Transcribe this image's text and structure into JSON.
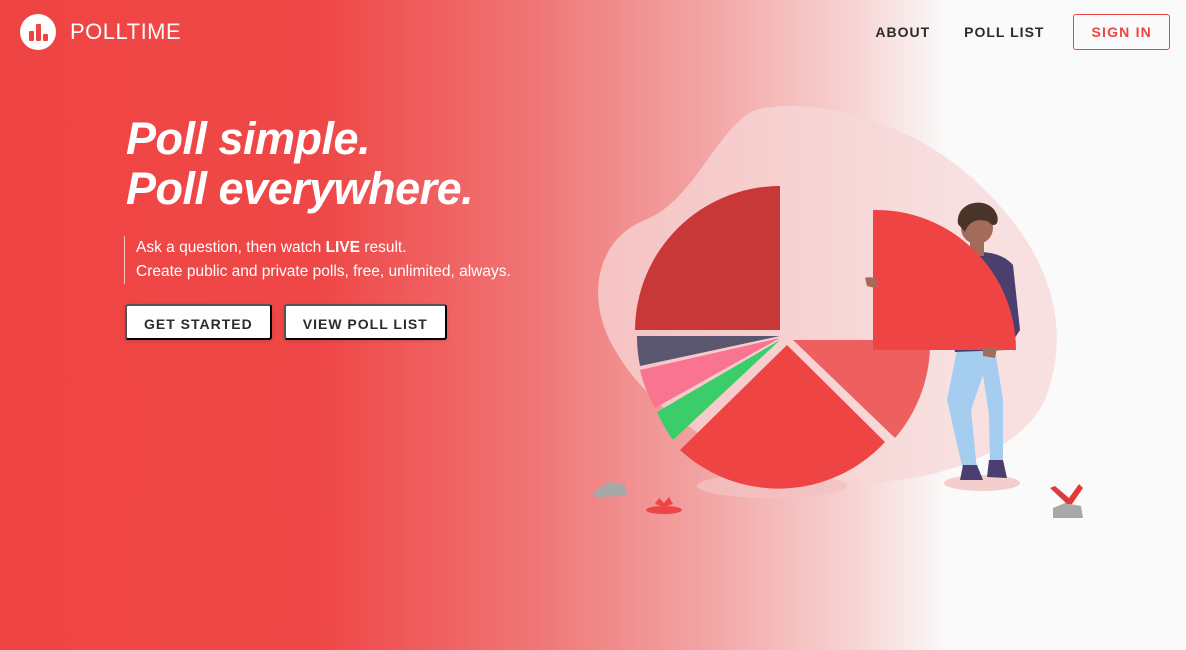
{
  "brand": {
    "name_bold": "POLL",
    "name_light": "TIME"
  },
  "nav": {
    "about": "ABOUT",
    "poll_list": "POLL LIST",
    "sign_in": "SIGN IN"
  },
  "hero": {
    "title_line1": "Poll simple.",
    "title_line2": "Poll everywhere.",
    "sub_line1_prefix": "Ask a question, then watch ",
    "sub_line1_bold": "LIVE",
    "sub_line1_suffix": " result.",
    "sub_line2": "Create public and private polls, free, unlimited, always."
  },
  "buttons": {
    "get_started": "GET STARTED",
    "view_poll_list": "VIEW POLL LIST"
  },
  "colors": {
    "accent": "#ef4444",
    "dark_red": "#c83838",
    "slate": "#5a5670",
    "pink": "#f87491",
    "green": "#3ccd6b",
    "light_red": "#ee6060"
  },
  "illustration": {
    "name": "person-with-pie-chart"
  }
}
